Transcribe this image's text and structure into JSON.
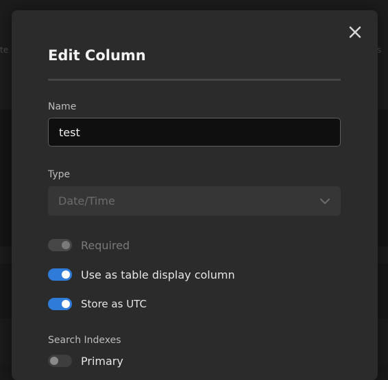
{
  "dialog": {
    "title": "Edit Column",
    "name_label": "Name",
    "name_value": "test",
    "type_label": "Type",
    "type_value": "Date/Time",
    "toggles": [
      {
        "label": "Required",
        "state": "on",
        "disabled": true
      },
      {
        "label": "Use as table display column",
        "state": "on",
        "disabled": false
      },
      {
        "label": "Store as UTC",
        "state": "on",
        "disabled": false
      }
    ],
    "search_indexes_label": "Search Indexes",
    "index_toggles": [
      {
        "label": "Primary",
        "state": "off",
        "disabled": false
      }
    ]
  },
  "background": {
    "left_fragment": "te",
    "right_fragment": "s"
  },
  "colors": {
    "accent": "#2f7bd9",
    "modal_bg": "#2b2b2b",
    "input_bg": "#0f0f0f"
  }
}
